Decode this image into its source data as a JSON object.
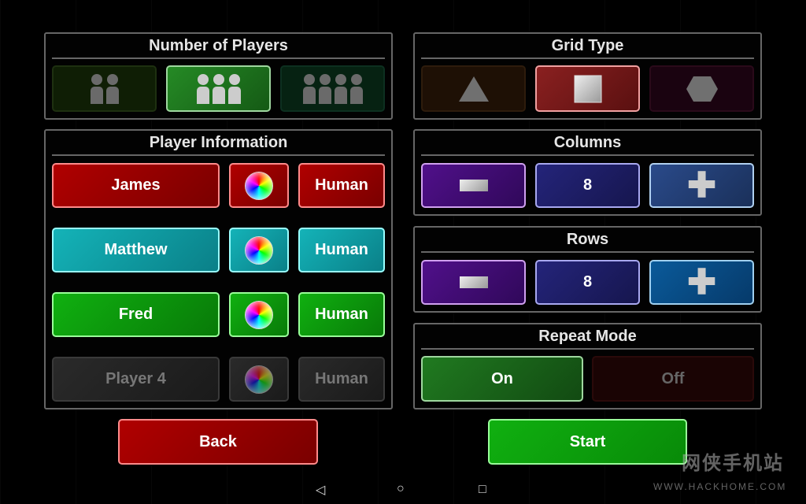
{
  "players_panel": {
    "title": "Number of Players",
    "options": [
      {
        "count": 2,
        "selected": false
      },
      {
        "count": 3,
        "selected": true
      },
      {
        "count": 4,
        "selected": false
      }
    ]
  },
  "player_info": {
    "title": "Player Information",
    "players": [
      {
        "name": "James",
        "type": "Human",
        "color": "#b00000",
        "active": true
      },
      {
        "name": "Matthew",
        "type": "Human",
        "color": "#14b3b8",
        "active": true
      },
      {
        "name": "Fred",
        "type": "Human",
        "color": "#10b010",
        "active": true
      },
      {
        "name": "Player 4",
        "type": "Human",
        "color": "#2a2a2a",
        "active": false
      }
    ]
  },
  "grid_type": {
    "title": "Grid Type",
    "options": [
      {
        "shape": "triangle-icon",
        "selected": false
      },
      {
        "shape": "square-icon",
        "selected": true
      },
      {
        "shape": "hexagon-icon",
        "selected": false
      }
    ]
  },
  "columns": {
    "title": "Columns",
    "value": "8"
  },
  "rows": {
    "title": "Rows",
    "value": "8"
  },
  "repeat_mode": {
    "title": "Repeat Mode",
    "on": "On",
    "off": "Off",
    "selected": "On"
  },
  "back": "Back",
  "start": "Start",
  "watermark": {
    "name": "网侠手机站",
    "url": "WWW.HACKHOME.COM"
  }
}
